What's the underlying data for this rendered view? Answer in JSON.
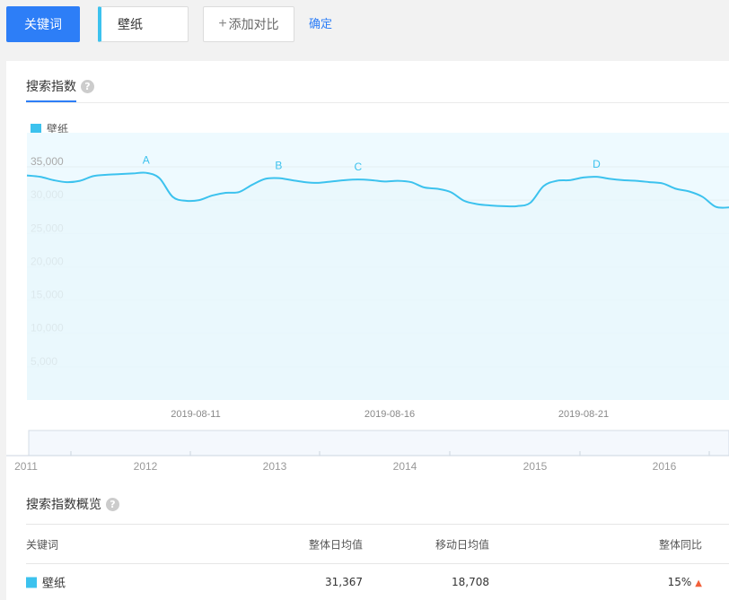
{
  "toolbar": {
    "keyword_button": "关键词",
    "keyword_value": "壁纸",
    "add_compare": "添加对比",
    "confirm": "确定"
  },
  "tabs": {
    "search_index": "搜索指数",
    "help": "?"
  },
  "legend": {
    "label": "壁纸"
  },
  "colors": {
    "accent": "#2d7ef7",
    "series": "#3cc2ee",
    "area": "#eefaff",
    "up": "#f2603a"
  },
  "chart_data": {
    "type": "area",
    "series": [
      {
        "name": "壁纸",
        "values": [
          33700,
          33500,
          33000,
          32700,
          32900,
          33600,
          33800,
          33900,
          34000,
          34100,
          33300,
          30500,
          29900,
          30000,
          30700,
          31100,
          31200,
          32300,
          33200,
          33300,
          33000,
          32700,
          32600,
          32800,
          33000,
          33100,
          33000,
          32800,
          32900,
          32700,
          31900,
          31700,
          31200,
          29900,
          29400,
          29200,
          29100,
          29100,
          29600,
          32100,
          32900,
          33000,
          33400,
          33500,
          33200,
          33000,
          32900,
          32700,
          32500,
          31700,
          31300,
          30500,
          29000,
          28900
        ]
      }
    ],
    "x_tick_labels": [
      "2019-08-11",
      "2019-08-16",
      "2019-08-21"
    ],
    "y_tick_labels": [
      "35,000",
      "30,000",
      "25,000",
      "20,000",
      "15,000",
      "10,000",
      "5,000"
    ],
    "yticks": [
      35000,
      30000,
      25000,
      20000,
      15000,
      10000,
      5000
    ],
    "ylim": [
      0,
      35000
    ],
    "annotations": [
      {
        "label": "A",
        "index": 9
      },
      {
        "label": "B",
        "index": 19
      },
      {
        "label": "C",
        "index": 25
      },
      {
        "label": "D",
        "index": 43
      }
    ],
    "navigator_years": [
      "2011",
      "2012",
      "2013",
      "2014",
      "2015",
      "2016"
    ],
    "grid": true
  },
  "overview": {
    "title": "搜索指数概览",
    "headers": {
      "keyword": "关键词",
      "overall_avg": "整体日均值",
      "mobile_avg": "移动日均值",
      "overall_yoy": "整体同比"
    },
    "rows": [
      {
        "keyword": "壁纸",
        "overall_avg": "31,367",
        "mobile_avg": "18,708",
        "overall_yoy": "15%"
      }
    ]
  }
}
